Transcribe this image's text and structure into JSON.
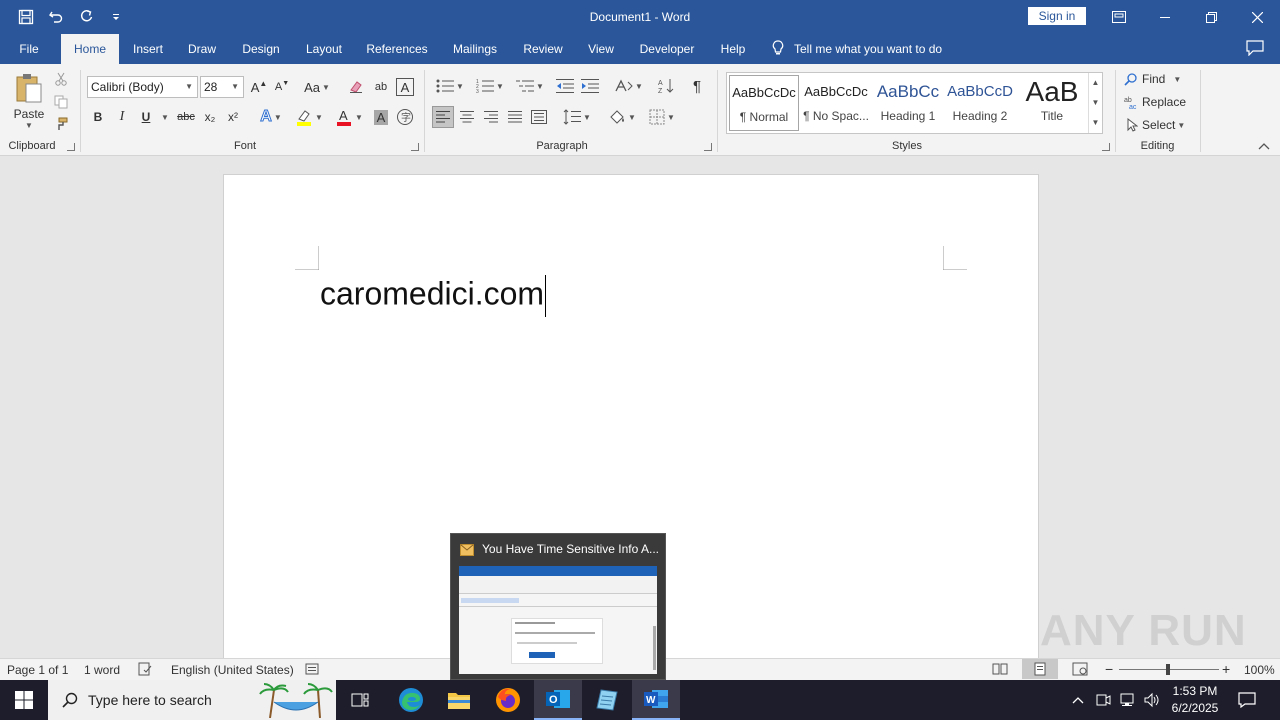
{
  "window": {
    "title": "Document1 - Word",
    "sign_in": "Sign in"
  },
  "tabs": [
    "File",
    "Home",
    "Insert",
    "Draw",
    "Design",
    "Layout",
    "References",
    "Mailings",
    "Review",
    "View",
    "Developer",
    "Help"
  ],
  "active_tab": "Home",
  "tell_me": "Tell me what you want to do",
  "ribbon": {
    "clipboard": {
      "paste": "Paste",
      "label": "Clipboard"
    },
    "font": {
      "name": "Calibri (Body)",
      "size": "28",
      "label": "Font",
      "bold": "B",
      "italic": "I",
      "underline": "U",
      "strike": "abc",
      "subscript": "x₂",
      "superscript": "x²",
      "change_case": "Aa"
    },
    "paragraph": {
      "label": "Paragraph",
      "pilcrow": "¶"
    },
    "styles": {
      "label": "Styles",
      "items": [
        {
          "preview": "AaBbCcDc",
          "name": "¶ Normal"
        },
        {
          "preview": "AaBbCcDc",
          "name": "¶ No Spac..."
        },
        {
          "preview": "AaBbCc",
          "name": "Heading 1"
        },
        {
          "preview": "AaBbCcD",
          "name": "Heading 2"
        },
        {
          "preview": "AaB",
          "name": "Title"
        }
      ]
    },
    "editing": {
      "label": "Editing",
      "find": "Find",
      "replace": "Replace",
      "select": "Select"
    }
  },
  "document": {
    "text": "caromedici.com"
  },
  "status": {
    "page": "Page 1 of 1",
    "words": "1 word",
    "language": "English (United States)",
    "zoom": "100%"
  },
  "taskbar": {
    "search_placeholder": "Type here to search",
    "time": "1:53 PM",
    "date": "6/2/2025"
  },
  "thumbnail": {
    "title": "You Have Time Sensitive Info A..."
  },
  "watermark": "ANY RUN",
  "colors": {
    "word_blue": "#2b579a",
    "ribbon_bg": "#f3f3f3",
    "taskbar": "#1d1d2b"
  }
}
